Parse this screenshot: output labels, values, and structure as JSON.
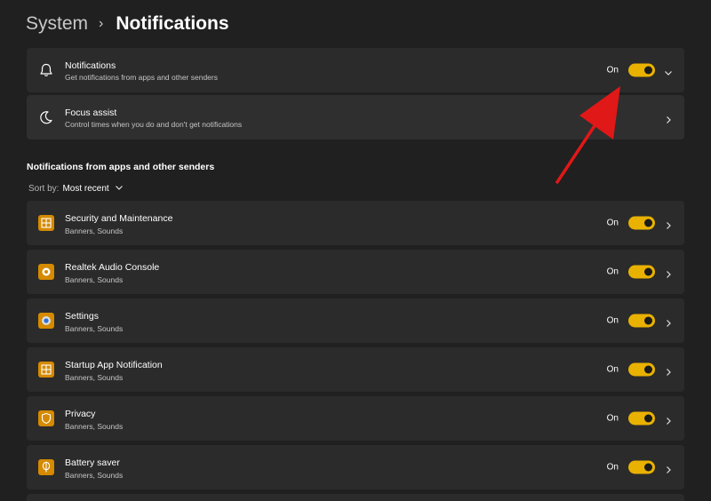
{
  "breadcrumb": {
    "parent": "System",
    "separator": "›",
    "current": "Notifications"
  },
  "notifications_card": {
    "title": "Notifications",
    "description": "Get notifications from apps and other senders",
    "status": "On",
    "toggle_on": true,
    "icon": "bell-icon"
  },
  "focus_card": {
    "title": "Focus assist",
    "description": "Control times when you do and don't get notifications",
    "icon": "moon-icon"
  },
  "apps_section": {
    "title": "Notifications from apps and other senders",
    "sort_label": "Sort by:",
    "sort_value": "Most recent"
  },
  "apps": [
    {
      "name": "Security and Maintenance",
      "detail": "Banners, Sounds",
      "status": "On",
      "toggle_on": true,
      "icon": "security-maintenance-icon"
    },
    {
      "name": "Realtek Audio Console",
      "detail": "Banners, Sounds",
      "status": "On",
      "toggle_on": true,
      "icon": "realtek-audio-icon"
    },
    {
      "name": "Settings",
      "detail": "Banners, Sounds",
      "status": "On",
      "toggle_on": true,
      "icon": "settings-gear-icon"
    },
    {
      "name": "Startup App Notification",
      "detail": "Banners, Sounds",
      "status": "On",
      "toggle_on": true,
      "icon": "startup-app-icon"
    },
    {
      "name": "Privacy",
      "detail": "Banners, Sounds",
      "status": "On",
      "toggle_on": true,
      "icon": "privacy-shield-icon"
    },
    {
      "name": "Battery saver",
      "detail": "Banners, Sounds",
      "status": "On",
      "toggle_on": true,
      "icon": "battery-saver-icon"
    }
  ],
  "colors": {
    "background": "#202020",
    "card": "#2b2b2b",
    "accent_toggle": "#e9b100",
    "app_icon": "#d58a00",
    "annotation_arrow": "#e01818"
  }
}
